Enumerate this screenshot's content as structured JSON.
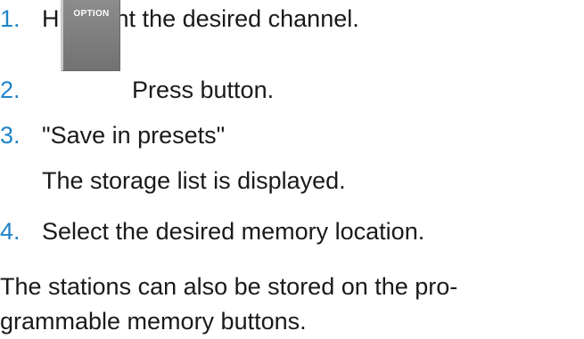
{
  "steps": [
    {
      "number": "1.",
      "text": "Highlight the desired channel."
    },
    {
      "number": "2.",
      "text": "Press button.",
      "button_label": "OPTION"
    },
    {
      "number": "3.",
      "text": "\"Save in presets\""
    },
    {
      "result": "The storage list is displayed."
    },
    {
      "number": "4.",
      "text": "Select the desired memory location."
    }
  ],
  "note": "The stations can also be stored on the pro-grammable memory buttons.",
  "note_lines": [
    "The stations can also be stored on the pro-",
    "grammable memory buttons."
  ],
  "colors": {
    "step_number": "#1f84c8",
    "text": "#1a1a1a",
    "button": "#7e7e7e"
  }
}
